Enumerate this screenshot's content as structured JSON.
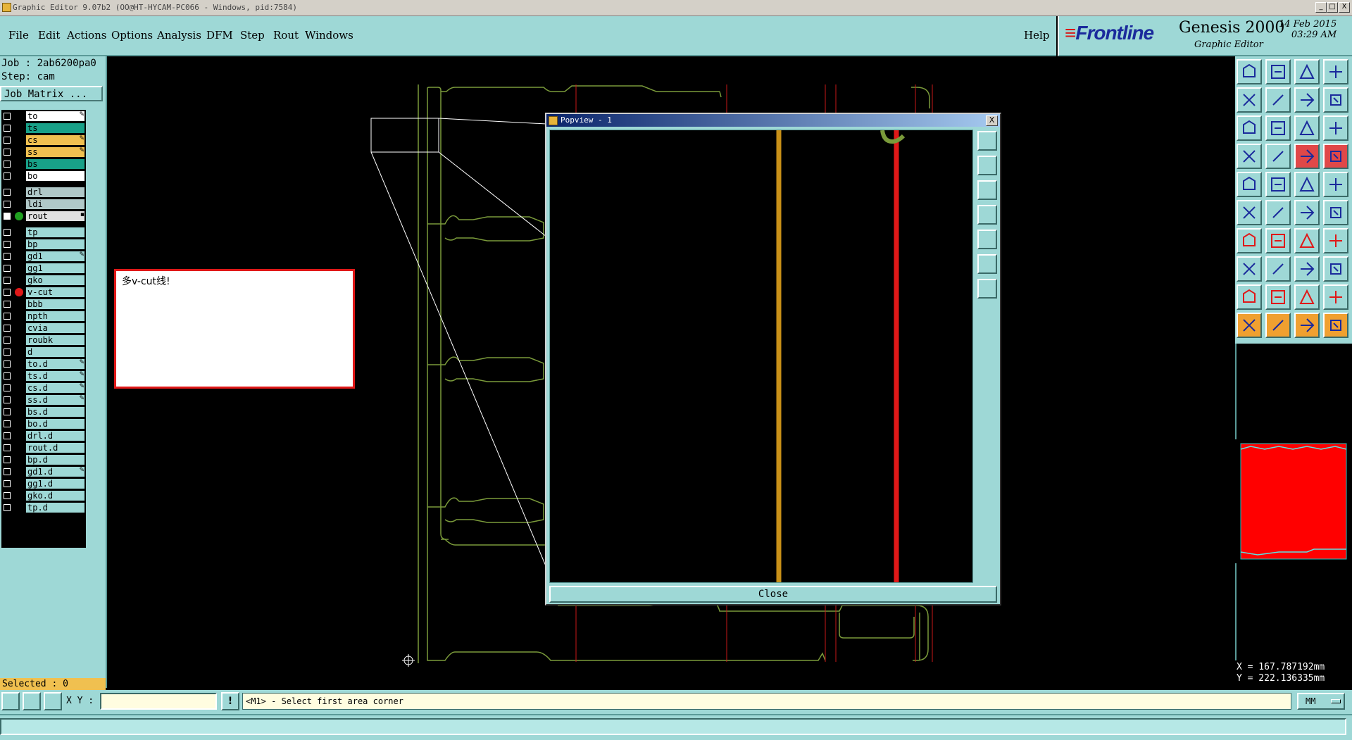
{
  "window": {
    "title": "Graphic Editor 9.07b2 (OO@HT-HYCAM-PC066 - Windows, pid:7584)",
    "buttons": [
      "_",
      "□",
      "X"
    ]
  },
  "menu": {
    "items": [
      "File",
      "Edit",
      "Actions",
      "Options",
      "Analysis",
      "DFM",
      "Step",
      "Rout",
      "Windows"
    ],
    "help": "Help"
  },
  "brand": {
    "logo": "Frontline",
    "product": "Genesis 2000",
    "module": "Graphic Editor",
    "date": "14 Feb 2015",
    "time": "03:29 AM"
  },
  "job": {
    "job_line": "Job : 2ab6200pa0",
    "step_line": "Step: cam",
    "matrix_button": "Job Matrix ..."
  },
  "layers": [
    {
      "name": "to",
      "color": "#ffffff",
      "mark": "✎"
    },
    {
      "name": "ts",
      "color": "#18a088",
      "mark": ""
    },
    {
      "name": "cs",
      "color": "#f0c050",
      "mark": "✎"
    },
    {
      "name": "ss",
      "color": "#f0c050",
      "mark": "✎"
    },
    {
      "name": "bs",
      "color": "#18a088",
      "mark": ""
    },
    {
      "name": "bo",
      "color": "#ffffff",
      "mark": ""
    },
    {
      "name": "drl",
      "color": "#b0c8c8",
      "mark": ""
    },
    {
      "name": "ldi",
      "color": "#b0c8c8",
      "mark": ""
    },
    {
      "name": "rout",
      "color": "#e0e0e0",
      "mark": "▪",
      "indicator": "#20a020",
      "checked": true
    },
    {
      "name": "tp",
      "color": "#9ed8d6",
      "mark": ""
    },
    {
      "name": "bp",
      "color": "#9ed8d6",
      "mark": ""
    },
    {
      "name": "gd1",
      "color": "#9ed8d6",
      "mark": "✎"
    },
    {
      "name": "gg1",
      "color": "#9ed8d6",
      "mark": ""
    },
    {
      "name": "gko",
      "color": "#9ed8d6",
      "mark": ""
    },
    {
      "name": "v-cut",
      "color": "#9ed8d6",
      "mark": "",
      "indicator": "#e01818"
    },
    {
      "name": "bbb",
      "color": "#9ed8d6",
      "mark": ""
    },
    {
      "name": "npth",
      "color": "#9ed8d6",
      "mark": ""
    },
    {
      "name": "cvia",
      "color": "#9ed8d6",
      "mark": ""
    },
    {
      "name": "roubk",
      "color": "#9ed8d6",
      "mark": ""
    },
    {
      "name": "d",
      "color": "#9ed8d6",
      "mark": ""
    },
    {
      "name": "to.d",
      "color": "#9ed8d6",
      "mark": "✎"
    },
    {
      "name": "ts.d",
      "color": "#9ed8d6",
      "mark": "✎"
    },
    {
      "name": "cs.d",
      "color": "#9ed8d6",
      "mark": "✎"
    },
    {
      "name": "ss.d",
      "color": "#9ed8d6",
      "mark": "✎"
    },
    {
      "name": "bs.d",
      "color": "#9ed8d6",
      "mark": ""
    },
    {
      "name": "bo.d",
      "color": "#9ed8d6",
      "mark": ""
    },
    {
      "name": "drl.d",
      "color": "#9ed8d6",
      "mark": ""
    },
    {
      "name": "rout.d",
      "color": "#9ed8d6",
      "mark": ""
    },
    {
      "name": "bp.d",
      "color": "#9ed8d6",
      "mark": ""
    },
    {
      "name": "gd1.d",
      "color": "#9ed8d6",
      "mark": "✎"
    },
    {
      "name": "gg1.d",
      "color": "#9ed8d6",
      "mark": ""
    },
    {
      "name": "gko.d",
      "color": "#9ed8d6",
      "mark": ""
    },
    {
      "name": "tp.d",
      "color": "#9ed8d6",
      "mark": ""
    }
  ],
  "selected": "Selected : 0",
  "note": "多v-cut线!",
  "popview": {
    "title": "Popview - 1",
    "close": "Close",
    "close_icon": "X"
  },
  "status": {
    "xy_label": "X Y :",
    "xy_value": "",
    "warn_icon": "!",
    "prompt": "<M1> - Select first area corner",
    "units": "MM"
  },
  "coords": {
    "x": "X = 167.787192mm",
    "y": "Y = 222.136335mm"
  },
  "colors": {
    "panel": "#9ed8d6",
    "outline": "#7a9a3a",
    "vcut": "#e01818",
    "trace": "#c89018"
  }
}
